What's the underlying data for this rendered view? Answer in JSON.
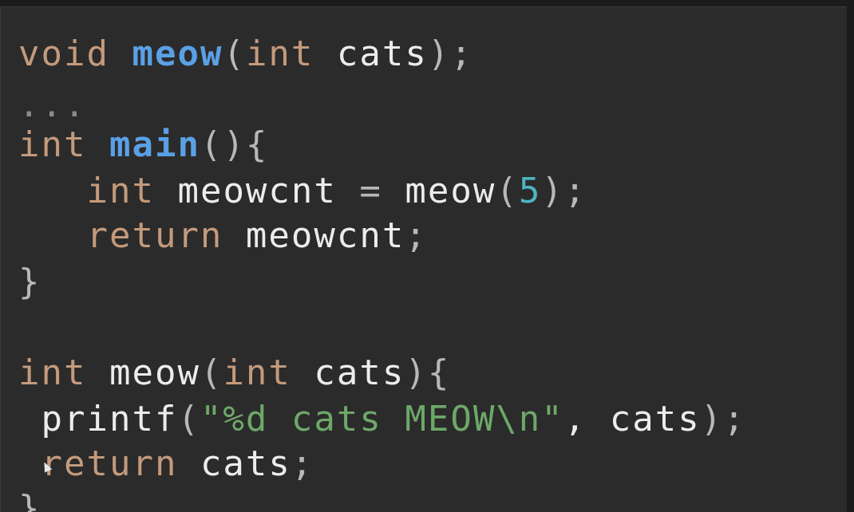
{
  "editor": {
    "theme": {
      "background": "#2b2b2b",
      "keyword": "#c49a7c",
      "function_decl": "#5aa0e6",
      "identifier": "#ececec",
      "number": "#4fb3c2",
      "string": "#6ea869"
    },
    "lines": [
      {
        "tokens": [
          {
            "t": "void",
            "c": "kw"
          },
          {
            "t": " ",
            "c": "id"
          },
          {
            "t": "meow",
            "c": "fn-decl"
          },
          {
            "t": "(",
            "c": "punc"
          },
          {
            "t": "int",
            "c": "kw"
          },
          {
            "t": " cats",
            "c": "id"
          },
          {
            "t": ");",
            "c": "punc"
          }
        ]
      },
      {
        "tokens": [
          {
            "t": "...",
            "c": "ellipsis"
          }
        ]
      },
      {
        "tokens": [
          {
            "t": "int",
            "c": "kw"
          },
          {
            "t": " ",
            "c": "id"
          },
          {
            "t": "main",
            "c": "fn-decl"
          },
          {
            "t": "(){",
            "c": "punc"
          }
        ]
      },
      {
        "tokens": [
          {
            "t": "   ",
            "c": "id"
          },
          {
            "t": "int",
            "c": "kw"
          },
          {
            "t": " meowcnt ",
            "c": "id"
          },
          {
            "t": "=",
            "c": "punc"
          },
          {
            "t": " meow",
            "c": "id"
          },
          {
            "t": "(",
            "c": "punc"
          },
          {
            "t": "5",
            "c": "num"
          },
          {
            "t": ");",
            "c": "punc"
          }
        ]
      },
      {
        "tokens": [
          {
            "t": "   ",
            "c": "id"
          },
          {
            "t": "return",
            "c": "kw"
          },
          {
            "t": " meowcnt",
            "c": "id"
          },
          {
            "t": ";",
            "c": "punc"
          }
        ]
      },
      {
        "tokens": [
          {
            "t": "}",
            "c": "punc"
          }
        ]
      },
      {
        "tokens": []
      },
      {
        "tokens": [
          {
            "t": "int",
            "c": "kw"
          },
          {
            "t": " meow",
            "c": "id"
          },
          {
            "t": "(",
            "c": "punc"
          },
          {
            "t": "int",
            "c": "kw"
          },
          {
            "t": " cats",
            "c": "id"
          },
          {
            "t": "){",
            "c": "punc"
          }
        ]
      },
      {
        "tokens": [
          {
            "t": " printf",
            "c": "id"
          },
          {
            "t": "(",
            "c": "punc"
          },
          {
            "t": "\"%d cats MEOW\\n\"",
            "c": "str"
          },
          {
            "t": ", cats",
            "c": "id"
          },
          {
            "t": ");",
            "c": "punc"
          }
        ]
      },
      {
        "tokens": [
          {
            "t": " ",
            "c": "id"
          },
          {
            "t": "return",
            "c": "kw"
          },
          {
            "t": " cats",
            "c": "id"
          },
          {
            "t": ";",
            "c": "punc"
          }
        ]
      },
      {
        "tokens": [
          {
            "t": "}",
            "c": "punc"
          }
        ]
      }
    ]
  }
}
